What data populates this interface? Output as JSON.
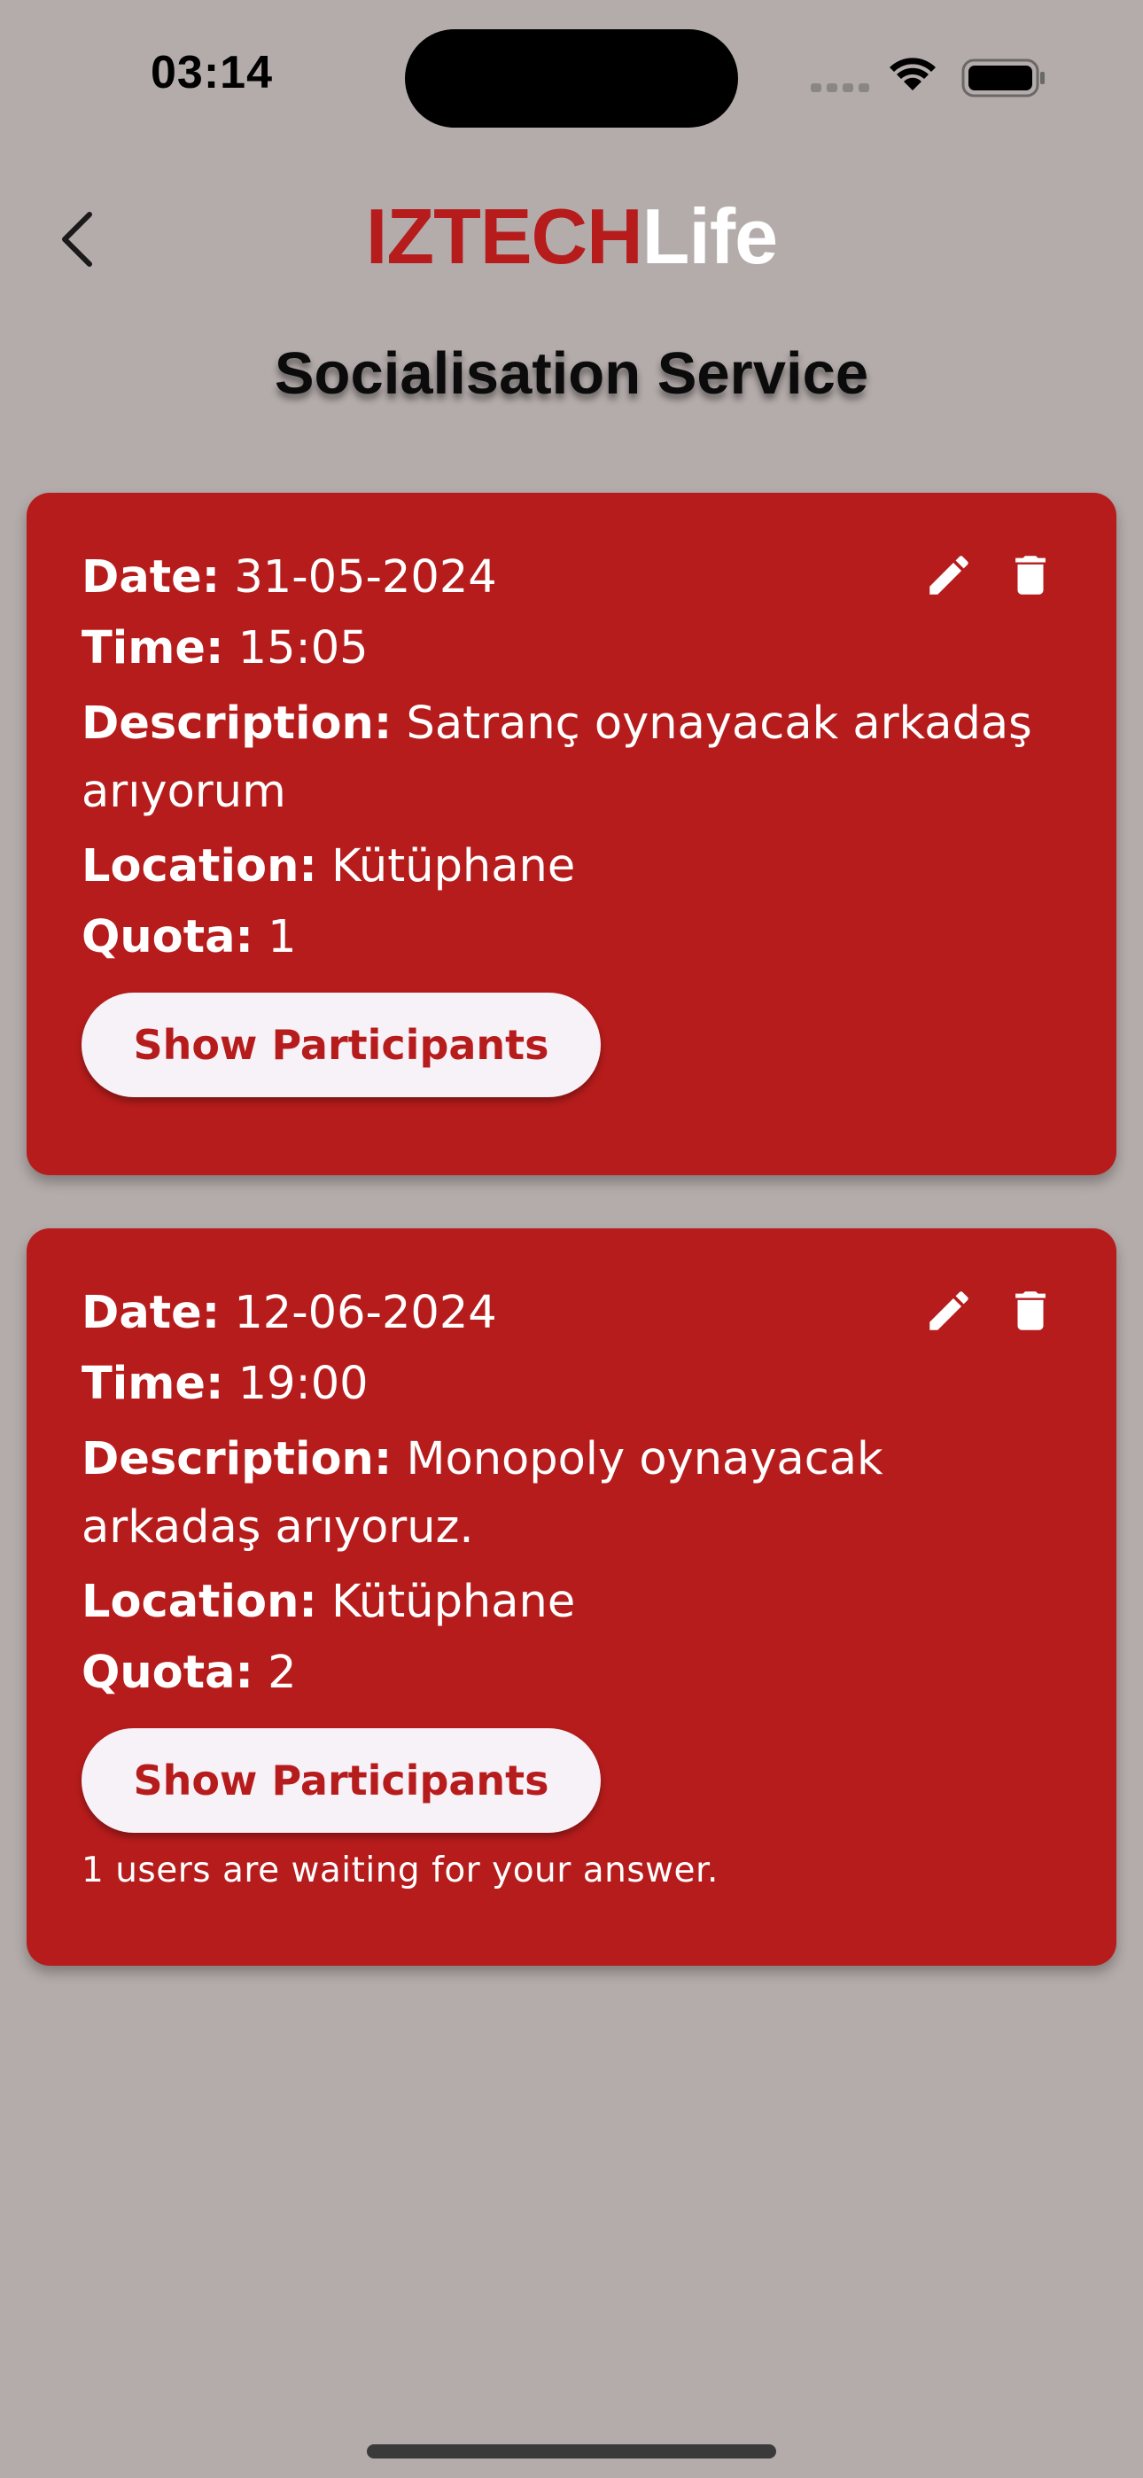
{
  "status_bar": {
    "time": "03:14"
  },
  "header": {
    "brand_part1": "IZTECH",
    "brand_part2": "Life",
    "title": "Socialisation Service"
  },
  "colors": {
    "brand_red": "#b71c1c",
    "background": "#b4acab",
    "button_bg": "#f7f1f8"
  },
  "labels": {
    "date": "Date:",
    "time": "Time:",
    "description": "Description:",
    "location": "Location:",
    "quota": "Quota:",
    "show_participants": "Show Participants"
  },
  "icons": {
    "back": "chevron-left-icon",
    "edit": "pencil-icon",
    "delete": "trash-icon"
  },
  "events": [
    {
      "date": "31-05-2024",
      "time": "15:05",
      "description": "Satranç oynayacak arkadaş arıyorum",
      "location": "Kütüphane",
      "quota": "1",
      "waiting_note": ""
    },
    {
      "date": "12-06-2024",
      "time": "19:00",
      "description": "Monopoly oynayacak arkadaş arıyoruz.",
      "location": "Kütüphane",
      "quota": "2",
      "waiting_note": "1 users are waiting for your answer."
    }
  ]
}
